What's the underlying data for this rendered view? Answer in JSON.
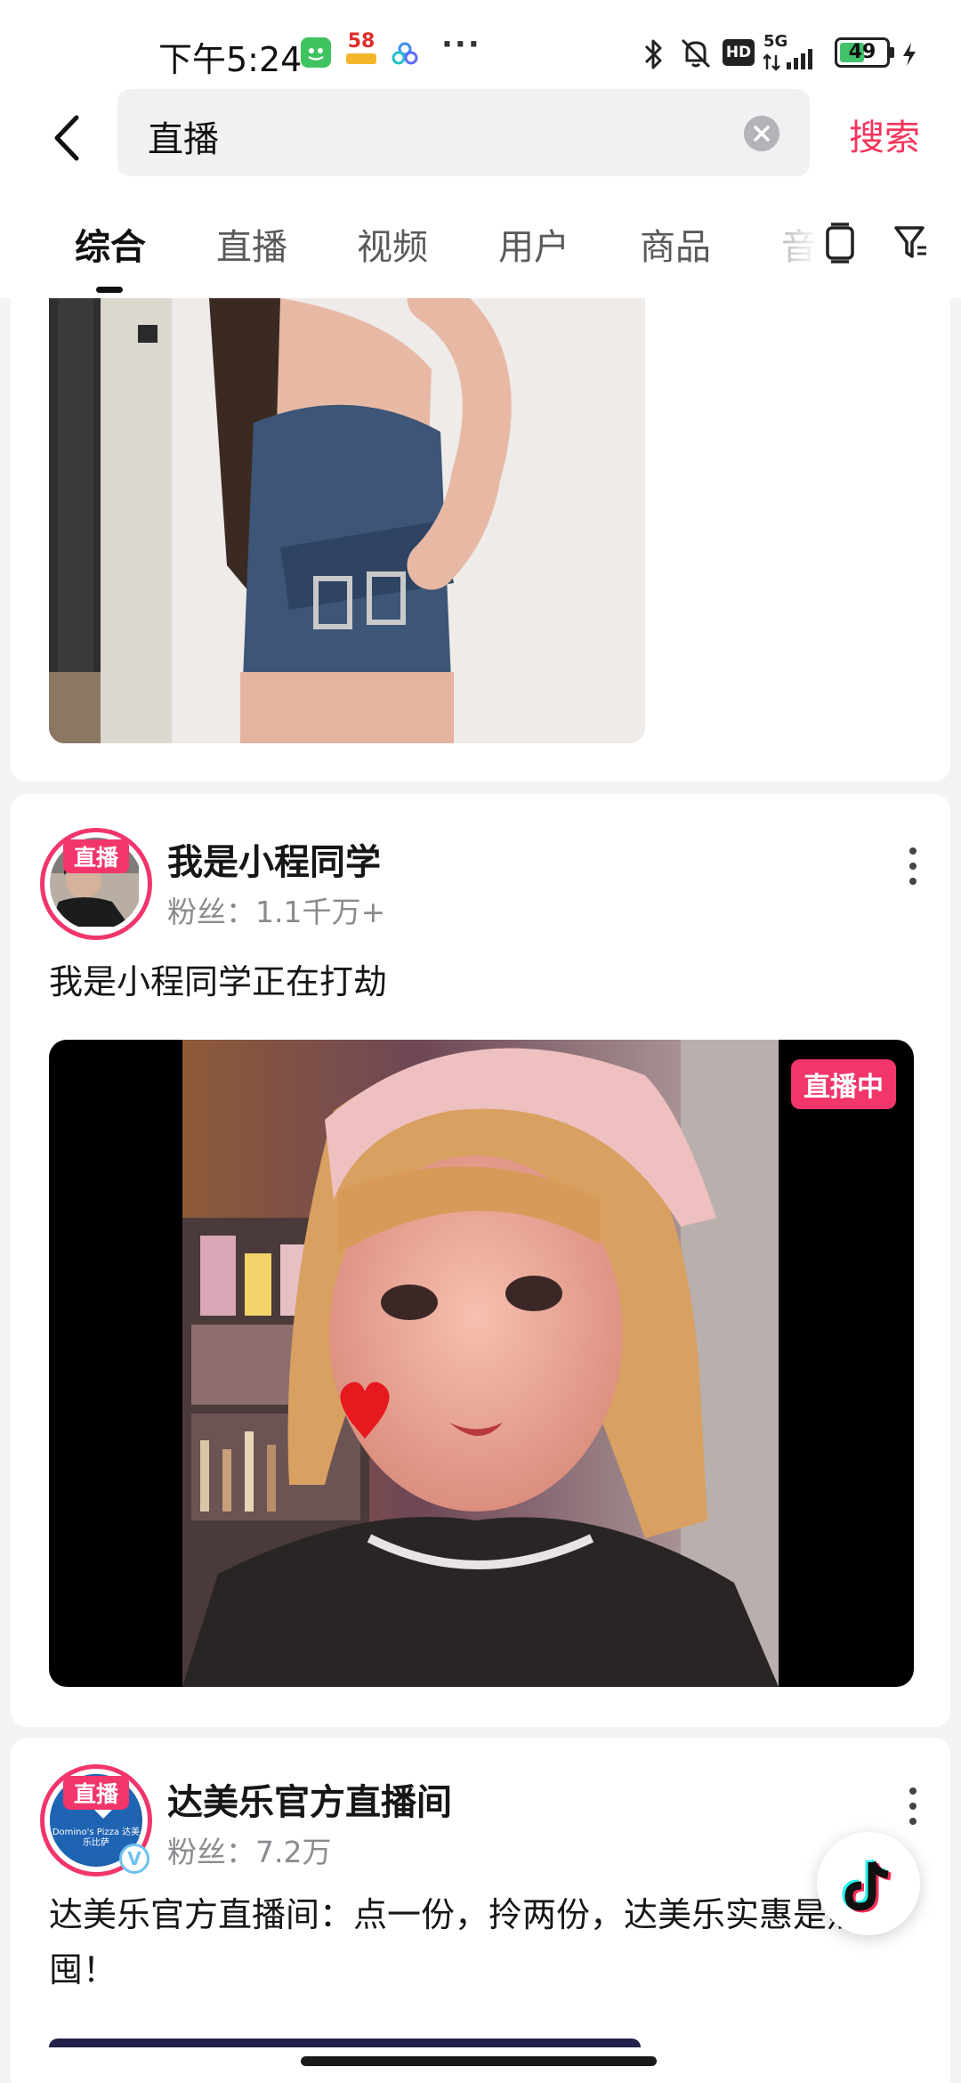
{
  "status_bar": {
    "time": "下午5:24",
    "app_badge_58": "58",
    "more_dots": "···",
    "network": "5G",
    "hd": "HD",
    "battery": "49"
  },
  "search": {
    "query": "直播",
    "submit_label": "搜索"
  },
  "tabs": [
    {
      "label": "综合",
      "active": true
    },
    {
      "label": "直播"
    },
    {
      "label": "视频"
    },
    {
      "label": "用户"
    },
    {
      "label": "商品"
    },
    {
      "label": "音"
    }
  ],
  "results": [
    {
      "kind": "video-card"
    },
    {
      "kind": "live-card",
      "avatar_chip": "直播",
      "user_name": "我是小程同学",
      "fans": "粉丝：1.1千万+",
      "caption": "我是小程同学正在打劫",
      "live_badge": "直播中"
    },
    {
      "kind": "live-card",
      "avatar_chip": "直播",
      "user_name": "达美乐官方直播间",
      "fans": "粉丝：7.2万",
      "caption": "达美乐官方直播间：点一份，拎两份，达美乐实惠是热囤！",
      "brand_logo_text": "Domino's Pizza 达美乐比萨",
      "verified_mark": "V"
    }
  ],
  "colors": {
    "accent": "#f5345c",
    "live_pink": "#f2356b",
    "battery_green": "#43c16b"
  },
  "icons": {
    "back": "chevron-left-icon",
    "clear": "close-circle-icon",
    "tab_tool_1": "phone-frame-icon",
    "tab_tool_2": "filter-icon",
    "more": "vertical-dots-icon",
    "fab": "tiktok-logo-icon"
  }
}
